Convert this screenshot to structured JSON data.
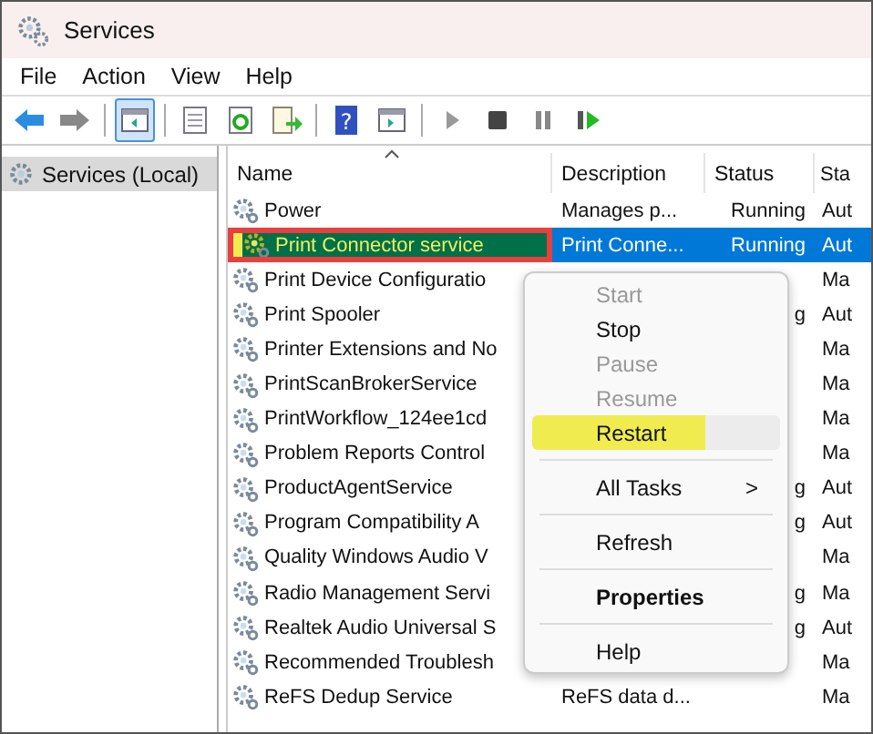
{
  "window": {
    "title": "Services"
  },
  "menu_bar": [
    "File",
    "Action",
    "View",
    "Help"
  ],
  "toolbar": [
    {
      "kind": "back",
      "selected": false
    },
    {
      "kind": "forward",
      "selected": false
    },
    {
      "kind": "sep",
      "selected": false
    },
    {
      "kind": "tree",
      "selected": true
    },
    {
      "kind": "sep",
      "selected": false
    },
    {
      "kind": "sheet",
      "selected": false
    },
    {
      "kind": "refresh",
      "selected": false
    },
    {
      "kind": "export",
      "selected": false
    },
    {
      "kind": "sep",
      "selected": false
    },
    {
      "kind": "help",
      "glyph": "?",
      "selected": false
    },
    {
      "kind": "console",
      "selected": false
    },
    {
      "kind": "sep",
      "selected": false
    },
    {
      "kind": "play",
      "selected": false
    },
    {
      "kind": "stop",
      "selected": false
    },
    {
      "kind": "pause",
      "selected": false
    },
    {
      "kind": "resume",
      "selected": false
    }
  ],
  "sidebar": {
    "items": [
      {
        "label": "Services (Local)",
        "selected": true
      }
    ]
  },
  "table": {
    "columns": [
      "Name",
      "Description",
      "Status",
      "Sta"
    ],
    "rows": [
      {
        "name": "Power",
        "description": "Manages p...",
        "status": "Running",
        "startup": "Aut",
        "selected": false,
        "highlighted": false
      },
      {
        "name": "Print Connector service",
        "description": "Print Conne...",
        "status": "Running",
        "startup": "Aut",
        "selected": true,
        "highlighted": true
      },
      {
        "name": "Print Device Configuratio",
        "description": "",
        "status": "",
        "startup": "Ma",
        "selected": false,
        "highlighted": false
      },
      {
        "name": "Print Spooler",
        "description": "",
        "status": "g",
        "startup": "Aut",
        "selected": false,
        "highlighted": false
      },
      {
        "name": "Printer Extensions and No",
        "description": "",
        "status": "",
        "startup": "Ma",
        "selected": false,
        "highlighted": false
      },
      {
        "name": "PrintScanBrokerService",
        "description": "",
        "status": "",
        "startup": "Ma",
        "selected": false,
        "highlighted": false
      },
      {
        "name": "PrintWorkflow_124ee1cd",
        "description": "",
        "status": "",
        "startup": "Ma",
        "selected": false,
        "highlighted": false
      },
      {
        "name": "Problem Reports Control",
        "description": "",
        "status": "",
        "startup": "Ma",
        "selected": false,
        "highlighted": false
      },
      {
        "name": "ProductAgentService",
        "description": "",
        "status": "g",
        "startup": "Aut",
        "selected": false,
        "highlighted": false
      },
      {
        "name": "Program Compatibility A",
        "description": "",
        "status": "g",
        "startup": "Aut",
        "selected": false,
        "highlighted": false
      },
      {
        "name": "Quality Windows Audio V",
        "description": "",
        "status": "",
        "startup": "Ma",
        "selected": false,
        "highlighted": false
      },
      {
        "name": "Radio Management Servi",
        "description": "",
        "status": "g",
        "startup": "Ma",
        "selected": false,
        "highlighted": false
      },
      {
        "name": "Realtek Audio Universal S",
        "description": "",
        "status": "g",
        "startup": "Aut",
        "selected": false,
        "highlighted": false
      },
      {
        "name": "Recommended Troublesh",
        "description": "",
        "status": "",
        "startup": "Ma",
        "selected": false,
        "highlighted": false
      },
      {
        "name": "ReFS Dedup Service",
        "description": "ReFS data d...",
        "status": "",
        "startup": "Ma",
        "selected": false,
        "highlighted": false
      }
    ]
  },
  "context_menu": [
    {
      "kind": "item",
      "label": "Start",
      "disabled": true,
      "highlighted": false
    },
    {
      "kind": "item",
      "label": "Stop",
      "disabled": false,
      "highlighted": false
    },
    {
      "kind": "item",
      "label": "Pause",
      "disabled": true,
      "highlighted": false
    },
    {
      "kind": "item",
      "label": "Resume",
      "disabled": true,
      "highlighted": false
    },
    {
      "kind": "item",
      "label": "Restart",
      "disabled": false,
      "highlighted": true
    },
    {
      "kind": "separator"
    },
    {
      "kind": "submenu",
      "label": "All Tasks",
      "chevron": ">",
      "disabled": false,
      "highlighted": false
    },
    {
      "kind": "separator"
    },
    {
      "kind": "item",
      "label": "Refresh",
      "disabled": false,
      "highlighted": false
    },
    {
      "kind": "separator"
    },
    {
      "kind": "default",
      "label": "Properties",
      "disabled": false,
      "highlighted": false
    },
    {
      "kind": "separator"
    },
    {
      "kind": "item",
      "label": "Help",
      "disabled": false,
      "highlighted": false
    }
  ]
}
